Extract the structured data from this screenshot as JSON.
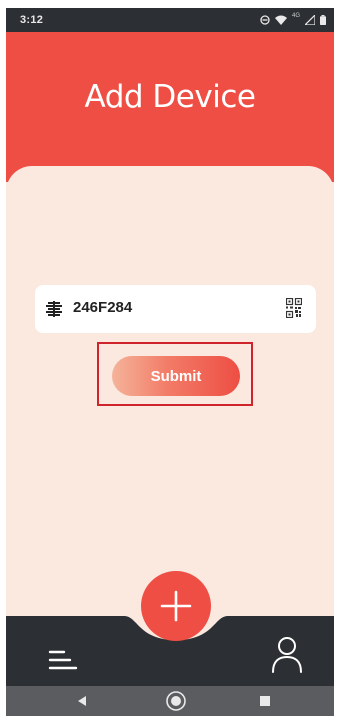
{
  "status_bar": {
    "time": "3:12",
    "network": "4G",
    "icons": [
      "do-not-disturb-icon",
      "wifi-icon",
      "signal-icon",
      "battery-icon"
    ]
  },
  "header": {
    "title": "Add Device"
  },
  "form": {
    "device_value": "246F284",
    "submit_label": "Submit"
  },
  "bottom_nav": {
    "items": [
      "menu-icon",
      "add-icon",
      "profile-icon"
    ]
  },
  "system_nav": {
    "items": [
      "back-icon",
      "home-icon",
      "recents-icon"
    ]
  },
  "colors": {
    "accent": "#ee4e44",
    "card_bg": "#fbe9e0",
    "bottom_bar": "#2c2f33",
    "nav_bar": "#5a5c60",
    "highlight": "#d0242c"
  }
}
